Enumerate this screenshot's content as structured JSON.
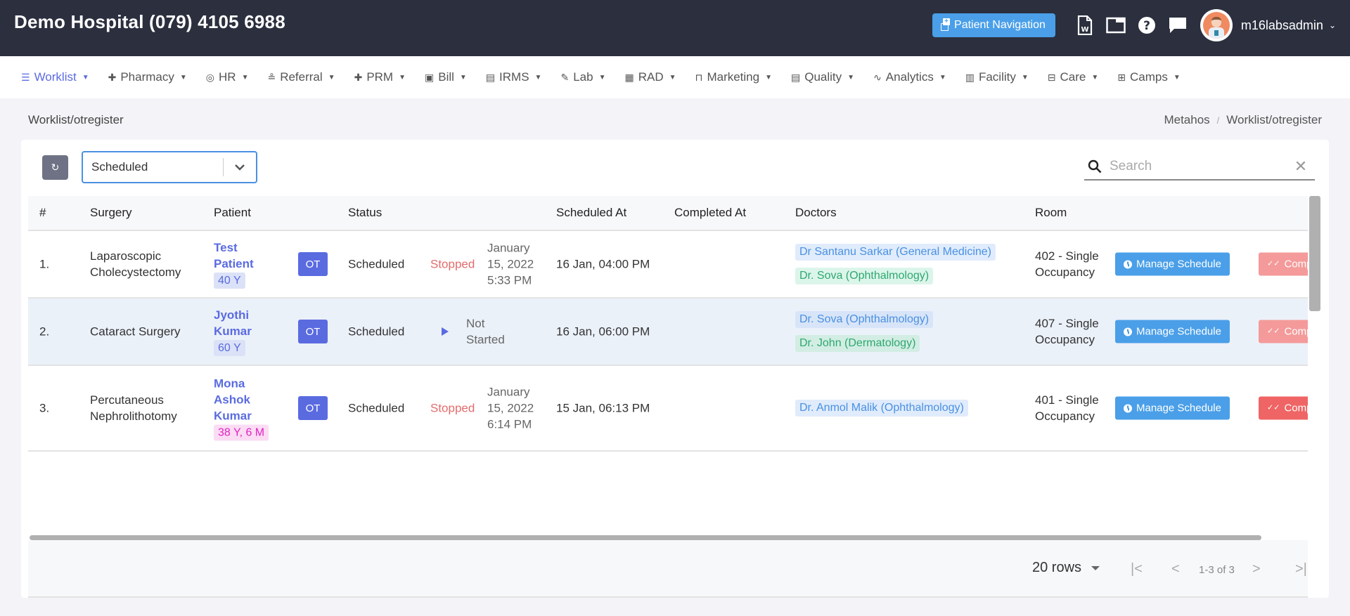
{
  "header": {
    "title": "Demo Hospital (079) 4105 6988",
    "patient_nav_label": "Patient Navigation",
    "icons": [
      "word-document-icon",
      "window-icon",
      "help-icon",
      "chat-icon"
    ],
    "username": "m16labsadmin"
  },
  "nav": {
    "items": [
      {
        "label": "Worklist",
        "icon": "list-icon",
        "glyph": "☰",
        "active": true
      },
      {
        "label": "Pharmacy",
        "icon": "plus-icon",
        "glyph": "✚"
      },
      {
        "label": "HR",
        "icon": "user-circle-icon",
        "glyph": "◎"
      },
      {
        "label": "Referral",
        "icon": "user-list-icon",
        "glyph": "≗"
      },
      {
        "label": "PRM",
        "icon": "plus-icon",
        "glyph": "✚"
      },
      {
        "label": "Bill",
        "icon": "money-icon",
        "glyph": "▣"
      },
      {
        "label": "IRMS",
        "icon": "id-card-icon",
        "glyph": "▤"
      },
      {
        "label": "Lab",
        "icon": "test-tube-icon",
        "glyph": "✎"
      },
      {
        "label": "RAD",
        "icon": "film-icon",
        "glyph": "▦"
      },
      {
        "label": "Marketing",
        "icon": "shopping-bag-icon",
        "glyph": "⊓"
      },
      {
        "label": "Quality",
        "icon": "id-card-icon",
        "glyph": "▤"
      },
      {
        "label": "Analytics",
        "icon": "pulse-icon",
        "glyph": "∿"
      },
      {
        "label": "Facility",
        "icon": "building-icon",
        "glyph": "▥"
      },
      {
        "label": "Care",
        "icon": "bed-icon",
        "glyph": "⊟"
      },
      {
        "label": "Camps",
        "icon": "briefcase-icon",
        "glyph": "⊞"
      }
    ]
  },
  "page": {
    "title": "Worklist/otregister",
    "breadcrumb": [
      "Metahos",
      "Worklist/otregister"
    ]
  },
  "toolbar": {
    "status_filter": "Scheduled",
    "search_placeholder": "Search",
    "search_value": ""
  },
  "table": {
    "columns": [
      "#",
      "Surgery",
      "Patient",
      "Status",
      "Scheduled At",
      "Completed At",
      "Doctors",
      "Room"
    ],
    "rows": [
      {
        "index": "1.",
        "surgery": "Laparoscopic Cholecystectomy",
        "patient": "Test Patient",
        "age": "40 Y",
        "age_color": "blue",
        "type": "OT",
        "status": "Scheduled",
        "progress_state": "Stopped",
        "progress_time": "January 15, 2022 5:33 PM",
        "scheduled_at": "16 Jan, 04:00 PM",
        "completed_at": "",
        "doctors": [
          {
            "name": "Dr Santanu Sarkar (General Medicine)",
            "color": "blue"
          },
          {
            "name": "Dr. Sova (Ophthalmology)",
            "color": "green"
          }
        ],
        "room": "402 - Single Occupancy",
        "manage_label": "Manage Schedule",
        "complete_label": "Complete"
      },
      {
        "index": "2.",
        "surgery": "Cataract Surgery",
        "patient": "Jyothi Kumar",
        "age": "60 Y",
        "age_color": "blue",
        "type": "OT",
        "status": "Scheduled",
        "progress_state": "Not Started",
        "progress_time": "",
        "scheduled_at": "16 Jan, 06:00 PM",
        "completed_at": "",
        "doctors": [
          {
            "name": "Dr. Sova (Ophthalmology)",
            "color": "blue"
          },
          {
            "name": "Dr. John (Dermatology)",
            "color": "green"
          }
        ],
        "room": "407 - Single Occupancy",
        "manage_label": "Manage Schedule",
        "complete_label": "Complete"
      },
      {
        "index": "3.",
        "surgery": "Percutaneous Nephrolithotomy",
        "patient": "Mona Ashok Kumar",
        "age": "38 Y, 6 M",
        "age_color": "pink",
        "type": "OT",
        "status": "Scheduled",
        "progress_state": "Stopped",
        "progress_time": "January 15, 2022 6:14 PM",
        "scheduled_at": "15 Jan, 06:13 PM",
        "completed_at": "",
        "doctors": [
          {
            "name": "Dr. Anmol Malik (Ophthalmology)",
            "color": "blue"
          }
        ],
        "room": "401 - Single Occupancy",
        "manage_label": "Manage Schedule",
        "complete_label": "Complete"
      }
    ]
  },
  "pagination": {
    "rows_per_page": "20 rows",
    "range": "1-3 of 3"
  },
  "colors": {
    "topbar": "#2b2f3e",
    "accent": "#5a6be0",
    "primary_button": "#4a9fe8",
    "danger": "#ef6464",
    "stopped_text": "#e56b6b"
  }
}
